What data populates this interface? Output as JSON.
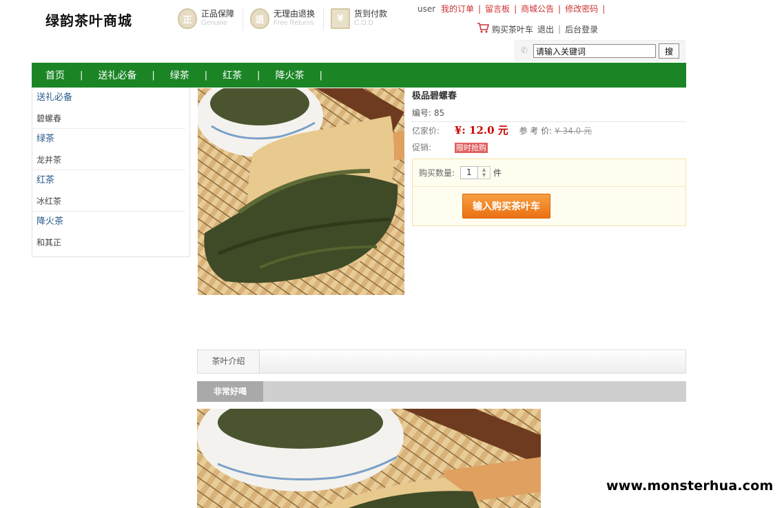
{
  "header": {
    "logo": "绿韵茶叶商城",
    "guarantees": [
      {
        "badge": "正",
        "cn": "正品保障",
        "en": "Genuine"
      },
      {
        "badge": "退",
        "cn": "无理由退换",
        "en": "Free Returns"
      },
      {
        "badge": "¥",
        "cn": "货到付款",
        "en": "C.O.D"
      }
    ],
    "user": "user",
    "links": [
      "我的订单",
      "留言板",
      "商城公告",
      "修改密码"
    ],
    "cart": "购买茶叶车",
    "logout": "退出",
    "admin": "后台登录",
    "search": {
      "value": "请输入关键词",
      "button": "搜"
    }
  },
  "nav": [
    "首页",
    "送礼必备",
    "绿茶",
    "红茶",
    "降火茶"
  ],
  "sidebar": [
    {
      "title": "送礼必备",
      "sub": "碧螺春"
    },
    {
      "title": "绿茶",
      "sub": "龙井茶"
    },
    {
      "title": "红茶",
      "sub": "冰红茶"
    },
    {
      "title": "降火茶",
      "sub": "和其正"
    }
  ],
  "product": {
    "name": "极品碧螺春",
    "id_label": "编号:",
    "id": "85",
    "price_label": "亿家价:",
    "price": "¥: 12.0 元",
    "ref_label": "参 考 价:",
    "ref_price": "¥ 34.0 元",
    "promo_label": "促销:",
    "promo": "限时抢购",
    "qty_label": "购买数量:",
    "qty": "1",
    "unit": "件",
    "add_button": "输入购买茶叶车"
  },
  "tabs": [
    "茶叶介绍"
  ],
  "description_title": "非常好喝",
  "watermark": "www.monsterhua.com",
  "colors": {
    "nav": "#1b8526",
    "accent": "#c33",
    "button": "#ea7012"
  }
}
